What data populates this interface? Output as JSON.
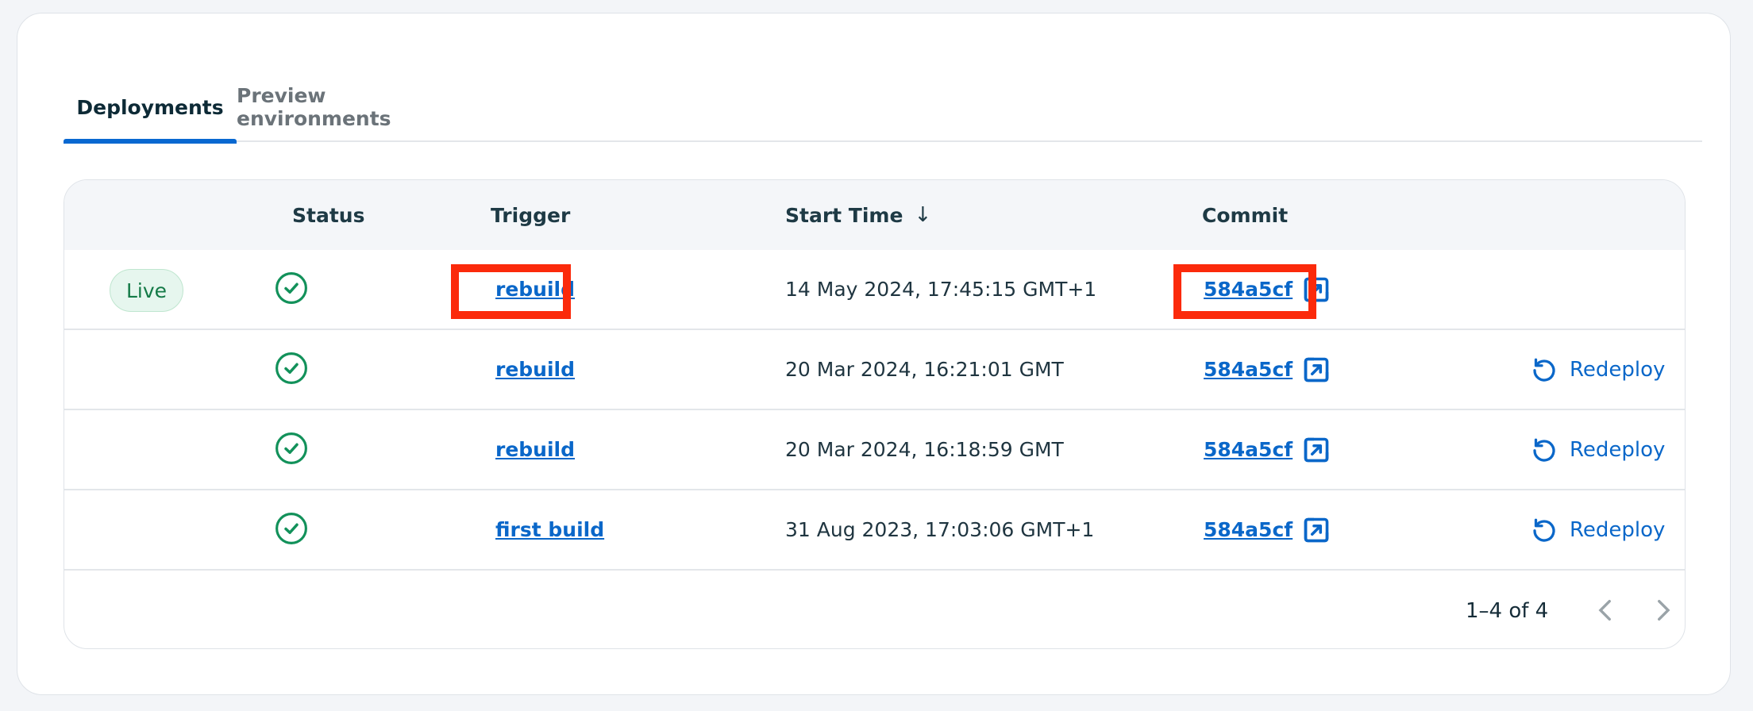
{
  "tabs": [
    {
      "label": "Deployments",
      "active": true
    },
    {
      "label": "Preview environments",
      "active": false
    }
  ],
  "table": {
    "headers": {
      "status": "Status",
      "trigger": "Trigger",
      "start_time": "Start Time",
      "start_time_sort": "descending",
      "commit": "Commit"
    },
    "rows": [
      {
        "badge": "Live",
        "status": "success",
        "trigger": "rebuild",
        "start_time": "14 May 2024, 17:45:15 GMT+1",
        "commit": "584a5cf",
        "action": ""
      },
      {
        "badge": "",
        "status": "success",
        "trigger": "rebuild",
        "start_time": "20 Mar 2024, 16:21:01 GMT",
        "commit": "584a5cf",
        "action": "Redeploy"
      },
      {
        "badge": "",
        "status": "success",
        "trigger": "rebuild",
        "start_time": "20 Mar 2024, 16:18:59 GMT",
        "commit": "584a5cf",
        "action": "Redeploy"
      },
      {
        "badge": "",
        "status": "success",
        "trigger": "first build",
        "start_time": "31 Aug 2023, 17:03:06 GMT+1",
        "commit": "584a5cf",
        "action": "Redeploy"
      }
    ]
  },
  "pagination": {
    "range": "1–4 of 4"
  },
  "colors": {
    "accent": "#0868d1",
    "link": "#0a67c9",
    "success": "#12915a",
    "highlight": "#fb2a0b"
  }
}
